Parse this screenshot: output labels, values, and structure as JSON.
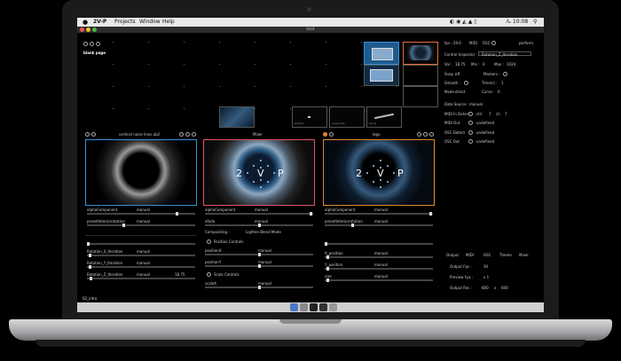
{
  "menubar": {
    "apple": "",
    "app_name": "2V-P",
    "items": [
      "Projects",
      "Window",
      "Help"
    ],
    "clock": "ん 10:08"
  },
  "window": {
    "title": "test"
  },
  "scene_grid": {
    "page_label": "blank page"
  },
  "thumb_labels": {
    "t5": "pattern",
    "t6": "grayscale",
    "t7": "spray"
  },
  "inspector": {
    "fps": "fps : 29.6",
    "midi_osc": "MIDI",
    "osc": "OSC",
    "perform": "perform",
    "control_inspector": "Control Inspector",
    "control_name": "Rotation_Z_Iteration",
    "val_label": "Val :",
    "val": "18.75",
    "min_label": "Min :",
    "min": "0",
    "max_label": "Max :",
    "max": "1024",
    "snap_label": "Snap :",
    "snap": "off",
    "markers_label": "Markers :",
    "smooth_label": "Smooth :",
    "time_label": "Time(s) :",
    "time": "1",
    "mode_label": "Mode :",
    "mode": "direct",
    "curve_label": "Curve :",
    "curve": "0",
    "datasource_label": "Data Source :",
    "datasource": "manual",
    "midi_in_label": "MIDI In Detect",
    "ctrl_label": "ctrl",
    "ctrl_val": "7",
    "ch_label": "ch",
    "ch_val": "7",
    "midi_out_label": "MIDI Out",
    "midi_out": "undefined",
    "osc_detect_label": "OSC Detect",
    "osc_detect": "undefined",
    "osc_out_label": "OSC Out",
    "osc_out": "undefined"
  },
  "left_panel": {
    "title": "vertical noise lines ab2",
    "component": "alphaComponent",
    "mode": "manual",
    "param": "presetInteriorrotation",
    "param_mode": "manual",
    "rows": [
      {
        "name": "Rotation_X_Iteration",
        "mode": "manual",
        "val": ""
      },
      {
        "name": "Rotation_Y_Iteration",
        "mode": "manual",
        "val": ""
      },
      {
        "name": "Rotation_Z_Iteration",
        "mode": "manual",
        "val": "18.75"
      }
    ]
  },
  "mixer": {
    "title": "Mixer",
    "component": "alphaComponent",
    "mode": "manual",
    "param": "xfade",
    "param_mode": "manual",
    "compositing": "Compositing :",
    "blend_mode": "Lighten Blend Mode",
    "position_controls": "Position Controls",
    "positionX": "positionX",
    "positionY": "positionY",
    "scale_controls": "Scale Controls",
    "scaleX": "scaleX",
    "row_mode": "manual"
  },
  "right_panel": {
    "title": "logo",
    "component": "alphaComponent",
    "mode": "manual",
    "param": "presetInteriorrotation",
    "param_mode": "manual",
    "rows": [
      {
        "name": "X_position",
        "mode": "manual"
      },
      {
        "name": "Y_position",
        "mode": "manual"
      },
      {
        "name": "size",
        "mode": "manual"
      }
    ]
  },
  "video_overlay": {
    "left": "2",
    "center": "V",
    "right": "P"
  },
  "output_tabs": [
    "Output",
    "MIDI",
    "OSC",
    "Theme",
    "Mixer"
  ],
  "output": {
    "fps_label": "Output Fps :",
    "fps": "30",
    "preview_label": "Preview Fps :",
    "preview": "x 1",
    "res_label": "Output Res :",
    "res_w": "800",
    "res_x": "x",
    "res_h": "600"
  },
  "status": {
    "bottom_left": "02_intro"
  },
  "colors": {
    "left_border": "#3a8fd6",
    "mixer_border": "#e0526a",
    "right_border": "#e08a2a",
    "accent_thumb": "#e46a3a"
  }
}
